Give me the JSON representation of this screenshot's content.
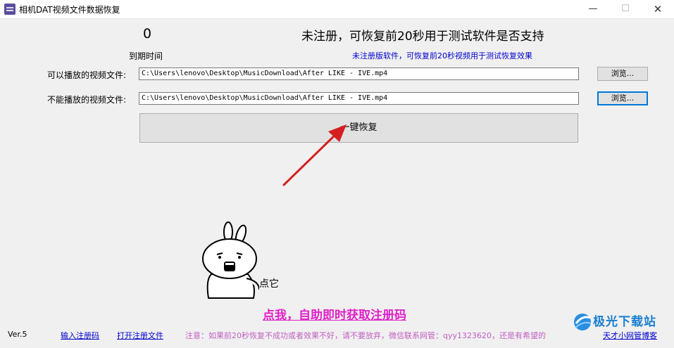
{
  "window": {
    "title": "相机DAT视频文件数据恢复",
    "minimize_glyph": "—",
    "maximize_glyph": "☐",
    "close_glyph": "✕"
  },
  "header": {
    "days_count": "0",
    "expire_label": "到期时间",
    "status_title": "未注册，可恢复前20秒用于测试软件是否支持",
    "status_subtitle": "未注册版软件，可恢复前20秒视频用于测试恢复效果"
  },
  "form": {
    "playable_label": "可以播放的视频文件:",
    "playable_path": "C:\\Users\\lenovo\\Desktop\\MusicDownload\\After  LIKE - IVE.mp4",
    "unplayable_label": "不能播放的视频文件:",
    "unplayable_path": "C:\\Users\\lenovo\\Desktop\\MusicDownload\\After  LIKE - IVE.mp4",
    "browse_label": "浏览...",
    "restore_button": "一键恢复"
  },
  "mascot": {
    "caption": "点它"
  },
  "promo": {
    "get_code_link": "点我，自助即时获取注册码"
  },
  "footer": {
    "version": "Ver.5",
    "enter_code_link": "输入注册码",
    "open_code_file_link": "打开注册文件",
    "notice": "注意：如果前20秒恢复不成功或者效果不好，请不要放弃，微信联系网管：qyy1323620，还是有希望的",
    "blog_link": "天才小网管博客"
  },
  "watermark": {
    "text": "极光下载站"
  },
  "colors": {
    "link_blue": "#0000cc",
    "promo_magenta": "#e020c8",
    "notice_pink": "#c060c0",
    "arrow_red": "#d42020",
    "focus_blue": "#0078d7"
  }
}
